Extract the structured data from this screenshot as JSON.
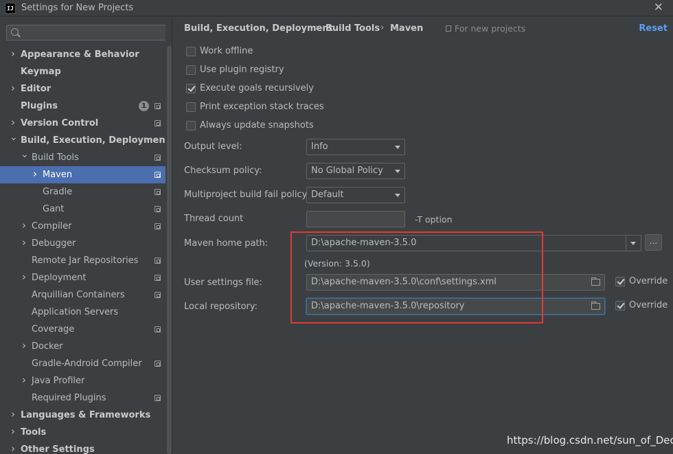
{
  "window": {
    "app_icon_text": "IJ",
    "title": "Settings for New Projects",
    "close_glyph": "✕"
  },
  "search": {
    "value": "",
    "placeholder": ""
  },
  "tree": [
    {
      "label": "Appearance & Behavior",
      "level": 0,
      "arrow": "right",
      "bold": true,
      "proj_icon": false
    },
    {
      "label": "Keymap",
      "level": 0,
      "arrow": "none",
      "bold": true,
      "proj_icon": false
    },
    {
      "label": "Editor",
      "level": 0,
      "arrow": "right",
      "bold": true,
      "proj_icon": false
    },
    {
      "label": "Plugins",
      "level": 0,
      "arrow": "none",
      "bold": true,
      "proj_icon": true,
      "badge": "1"
    },
    {
      "label": "Version Control",
      "level": 0,
      "arrow": "right",
      "bold": true,
      "proj_icon": true
    },
    {
      "label": "Build, Execution, Deployment",
      "level": 0,
      "arrow": "down",
      "bold": true,
      "proj_icon": false
    },
    {
      "label": "Build Tools",
      "level": 1,
      "arrow": "down",
      "bold": false,
      "proj_icon": true
    },
    {
      "label": "Maven",
      "level": 2,
      "arrow": "right",
      "bold": false,
      "proj_icon": true,
      "selected": true
    },
    {
      "label": "Gradle",
      "level": 2,
      "arrow": "none",
      "bold": false,
      "proj_icon": true
    },
    {
      "label": "Gant",
      "level": 2,
      "arrow": "none",
      "bold": false,
      "proj_icon": true
    },
    {
      "label": "Compiler",
      "level": 1,
      "arrow": "right",
      "bold": false,
      "proj_icon": true
    },
    {
      "label": "Debugger",
      "level": 1,
      "arrow": "right",
      "bold": false,
      "proj_icon": false
    },
    {
      "label": "Remote Jar Repositories",
      "level": 1,
      "arrow": "none",
      "bold": false,
      "proj_icon": true
    },
    {
      "label": "Deployment",
      "level": 1,
      "arrow": "right",
      "bold": false,
      "proj_icon": true
    },
    {
      "label": "Arquillian Containers",
      "level": 1,
      "arrow": "none",
      "bold": false,
      "proj_icon": true
    },
    {
      "label": "Application Servers",
      "level": 1,
      "arrow": "none",
      "bold": false,
      "proj_icon": false
    },
    {
      "label": "Coverage",
      "level": 1,
      "arrow": "none",
      "bold": false,
      "proj_icon": true
    },
    {
      "label": "Docker",
      "level": 1,
      "arrow": "right",
      "bold": false,
      "proj_icon": false
    },
    {
      "label": "Gradle-Android Compiler",
      "level": 1,
      "arrow": "none",
      "bold": false,
      "proj_icon": true
    },
    {
      "label": "Java Profiler",
      "level": 1,
      "arrow": "right",
      "bold": false,
      "proj_icon": false
    },
    {
      "label": "Required Plugins",
      "level": 1,
      "arrow": "none",
      "bold": false,
      "proj_icon": true
    },
    {
      "label": "Languages & Frameworks",
      "level": 0,
      "arrow": "right",
      "bold": true,
      "proj_icon": false
    },
    {
      "label": "Tools",
      "level": 0,
      "arrow": "right",
      "bold": true,
      "proj_icon": false
    },
    {
      "label": "Other Settings",
      "level": 0,
      "arrow": "right",
      "bold": true,
      "proj_icon": false
    }
  ],
  "breadcrumb": {
    "items": [
      "Build, Execution, Deployment",
      "Build Tools",
      "Maven"
    ],
    "separator": "›",
    "scope_label": "For new projects",
    "reset_label": "Reset"
  },
  "checkboxes": [
    {
      "label": "Work offline",
      "checked": false
    },
    {
      "label": "Use plugin registry",
      "checked": false
    },
    {
      "label": "Execute goals recursively",
      "checked": true
    },
    {
      "label": "Print exception stack traces",
      "checked": false
    },
    {
      "label": "Always update snapshots",
      "checked": false
    }
  ],
  "form": {
    "output_level": {
      "label": "Output level:",
      "value": "Info"
    },
    "checksum_policy": {
      "label": "Checksum policy:",
      "value": "No Global Policy"
    },
    "fail_policy": {
      "label": "Multiproject build fail policy:",
      "value": "Default"
    },
    "thread_count": {
      "label": "Thread count",
      "value": "",
      "hint": "-T option"
    },
    "maven_home": {
      "label": "Maven home path:",
      "value": "D:\\apache-maven-3.5.0",
      "browse_label": "...",
      "version": "(Version: 3.5.0)"
    },
    "user_settings": {
      "label": "User settings file:",
      "value": "D:\\apache-maven-3.5.0\\conf\\settings.xml",
      "override_label": "Override",
      "override_checked": true
    },
    "local_repo": {
      "label": "Local repository:",
      "value": "D:\\apache-maven-3.5.0\\repository",
      "override_label": "Override",
      "override_checked": true
    }
  },
  "annotation_color": "#e53935",
  "watermark": "https://blog.csdn.net/sun_of_Dec"
}
